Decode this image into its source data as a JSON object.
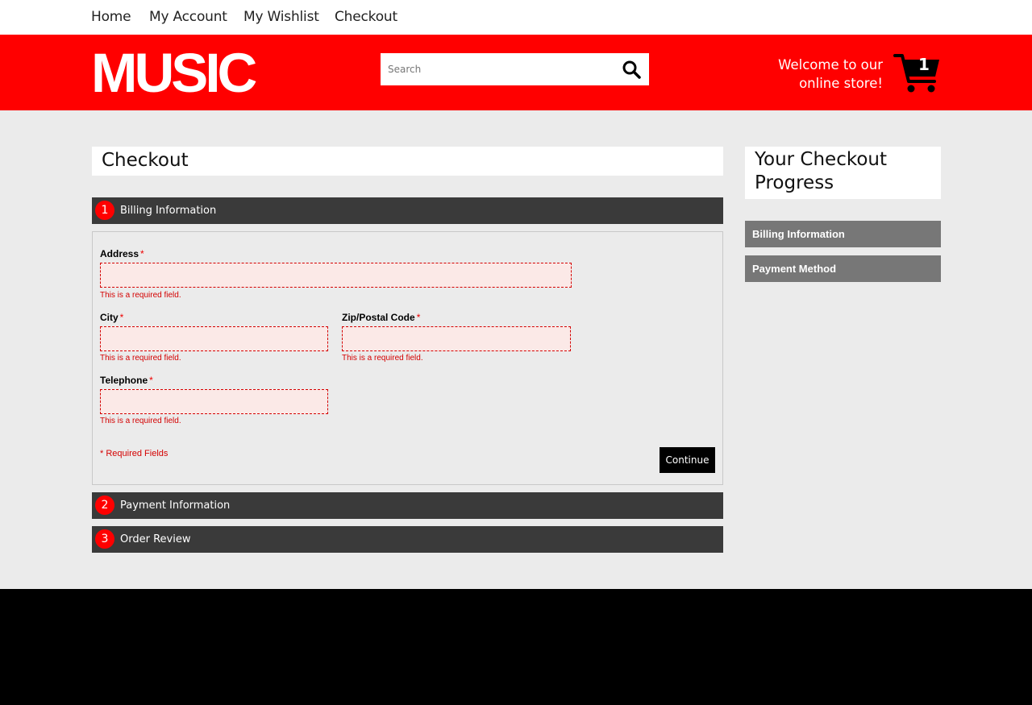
{
  "nav": {
    "items": [
      "Home",
      "My Account",
      "My Wishlist",
      "Checkout"
    ]
  },
  "header": {
    "logo": "MUSIC",
    "search_placeholder": "Search",
    "welcome_line1": "Welcome to our",
    "welcome_line2": "online store!",
    "cart_count": "1"
  },
  "checkout": {
    "title": "Checkout",
    "steps": [
      {
        "num": "1",
        "label": "Billing Information"
      },
      {
        "num": "2",
        "label": "Payment Information"
      },
      {
        "num": "3",
        "label": "Order Review"
      }
    ],
    "billing": {
      "address_label": "Address",
      "city_label": "City",
      "zip_label": "Zip/Postal Code",
      "telephone_label": "Telephone",
      "required_mark": "*",
      "error_text": "This is a required field.",
      "required_note": "* Required Fields",
      "continue_label": "Continue"
    }
  },
  "sidebar": {
    "title": "Your Checkout Progress",
    "items": [
      "Billing Information",
      "Payment Method"
    ]
  },
  "colors": {
    "brand": "#ff0000",
    "step_bar": "#3a3a3a",
    "error": "#d40000"
  }
}
